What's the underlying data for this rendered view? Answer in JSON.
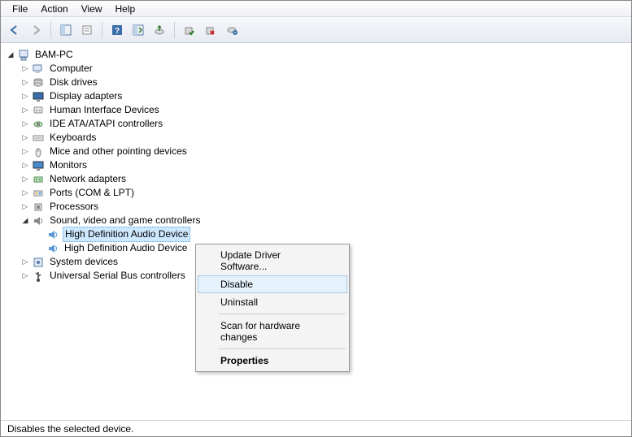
{
  "menu": {
    "file": "File",
    "action": "Action",
    "view": "View",
    "help": "Help"
  },
  "toolbar": {
    "back": "back-icon",
    "forward": "forward-icon",
    "show_hide_tree": "show-hide-tree-icon",
    "properties": "properties-icon",
    "help": "help-icon",
    "refresh": "refresh-icon",
    "update_driver": "update-driver-icon",
    "enable": "enable-icon",
    "disable": "disable-icon",
    "uninstall": "uninstall-icon"
  },
  "tree": {
    "root": "BAM-PC",
    "items": [
      {
        "label": "Computer"
      },
      {
        "label": "Disk drives"
      },
      {
        "label": "Display adapters"
      },
      {
        "label": "Human Interface Devices"
      },
      {
        "label": "IDE ATA/ATAPI controllers"
      },
      {
        "label": "Keyboards"
      },
      {
        "label": "Mice and other pointing devices"
      },
      {
        "label": "Monitors"
      },
      {
        "label": "Network adapters"
      },
      {
        "label": "Ports (COM & LPT)"
      },
      {
        "label": "Processors"
      },
      {
        "label": "Sound, video and game controllers",
        "expanded": true,
        "children": [
          {
            "label": "High Definition Audio Device",
            "selected": true
          },
          {
            "label": "High Definition Audio Device"
          }
        ]
      },
      {
        "label": "System devices"
      },
      {
        "label": "Universal Serial Bus controllers"
      }
    ]
  },
  "ctx": {
    "update": "Update Driver Software...",
    "disable": "Disable",
    "uninstall": "Uninstall",
    "scan": "Scan for hardware changes",
    "properties": "Properties"
  },
  "status": "Disables the selected device."
}
